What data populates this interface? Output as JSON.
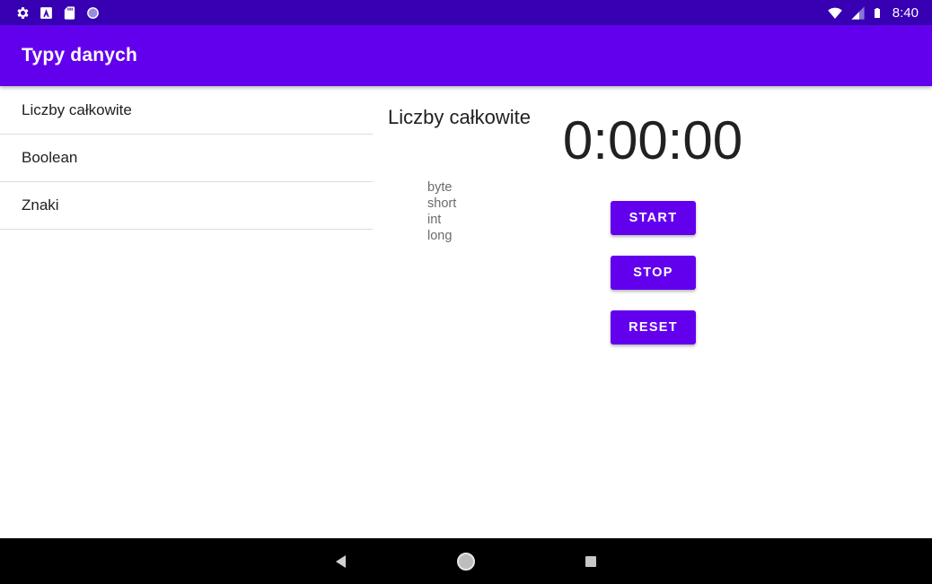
{
  "status_bar": {
    "time": "8:40",
    "left_icons": [
      "gear-icon",
      "app-a-icon",
      "sd-card-icon",
      "circle-icon"
    ],
    "right_icons": [
      "wifi-icon",
      "cellular-signal-icon",
      "battery-icon"
    ]
  },
  "app_bar": {
    "title": "Typy danych"
  },
  "list": {
    "items": [
      {
        "label": "Liczby całkowite"
      },
      {
        "label": "Boolean"
      },
      {
        "label": "Znaki"
      }
    ]
  },
  "detail": {
    "title": "Liczby całkowite",
    "types": [
      "byte",
      "short",
      "int",
      "long"
    ]
  },
  "stopwatch": {
    "time": "0:00:00",
    "start_label": "START",
    "stop_label": "STOP",
    "reset_label": "RESET"
  },
  "nav_bar": {
    "icons": [
      "back-icon",
      "home-icon",
      "recents-icon"
    ]
  },
  "colors": {
    "status_bar": "#3700b3",
    "primary": "#6200ee",
    "nav_bar": "#000000"
  }
}
